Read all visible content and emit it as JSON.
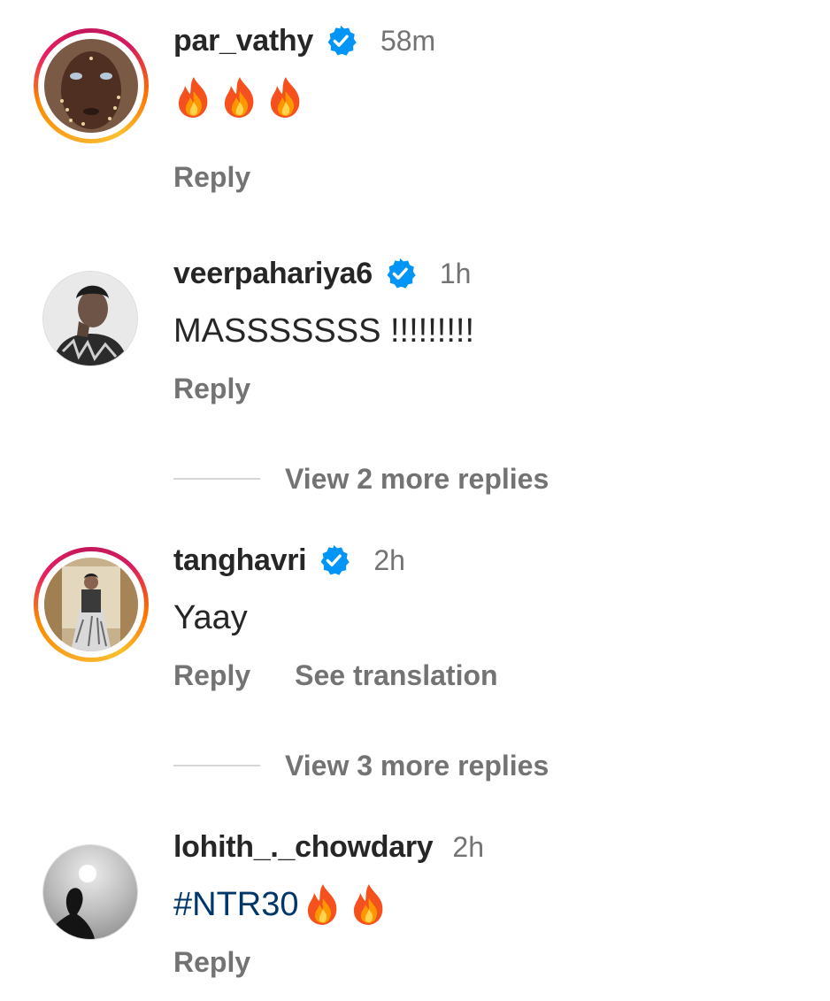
{
  "comments": [
    {
      "username": "par_vathy",
      "verified": true,
      "time": "58m",
      "text": "",
      "emojis": [
        "fire-emoji",
        "fire-emoji",
        "fire-emoji"
      ],
      "actions": [
        "Reply"
      ],
      "has_story_ring": true
    },
    {
      "username": "veerpahariya6",
      "verified": true,
      "time": "1h",
      "text": "MASSSSSSS !!!!!!!!!",
      "actions": [
        "Reply"
      ],
      "has_story_ring": false,
      "more_replies": "View 2 more replies"
    },
    {
      "username": "tanghavri",
      "verified": true,
      "time": "2h",
      "text": "Yaay",
      "actions": [
        "Reply",
        "See translation"
      ],
      "has_story_ring": true,
      "more_replies": "View 3 more replies"
    },
    {
      "username": "lohith_._chowdary",
      "verified": false,
      "time": "2h",
      "text": "#NTR30",
      "emojis": [
        "fire-emoji",
        "fire-emoji"
      ],
      "actions": [
        "Reply"
      ],
      "has_story_ring": false
    }
  ],
  "colors": {
    "username": "#262626",
    "secondary": "#737373",
    "verified_badge": "#0095f6",
    "hashtag": "#00376b"
  }
}
